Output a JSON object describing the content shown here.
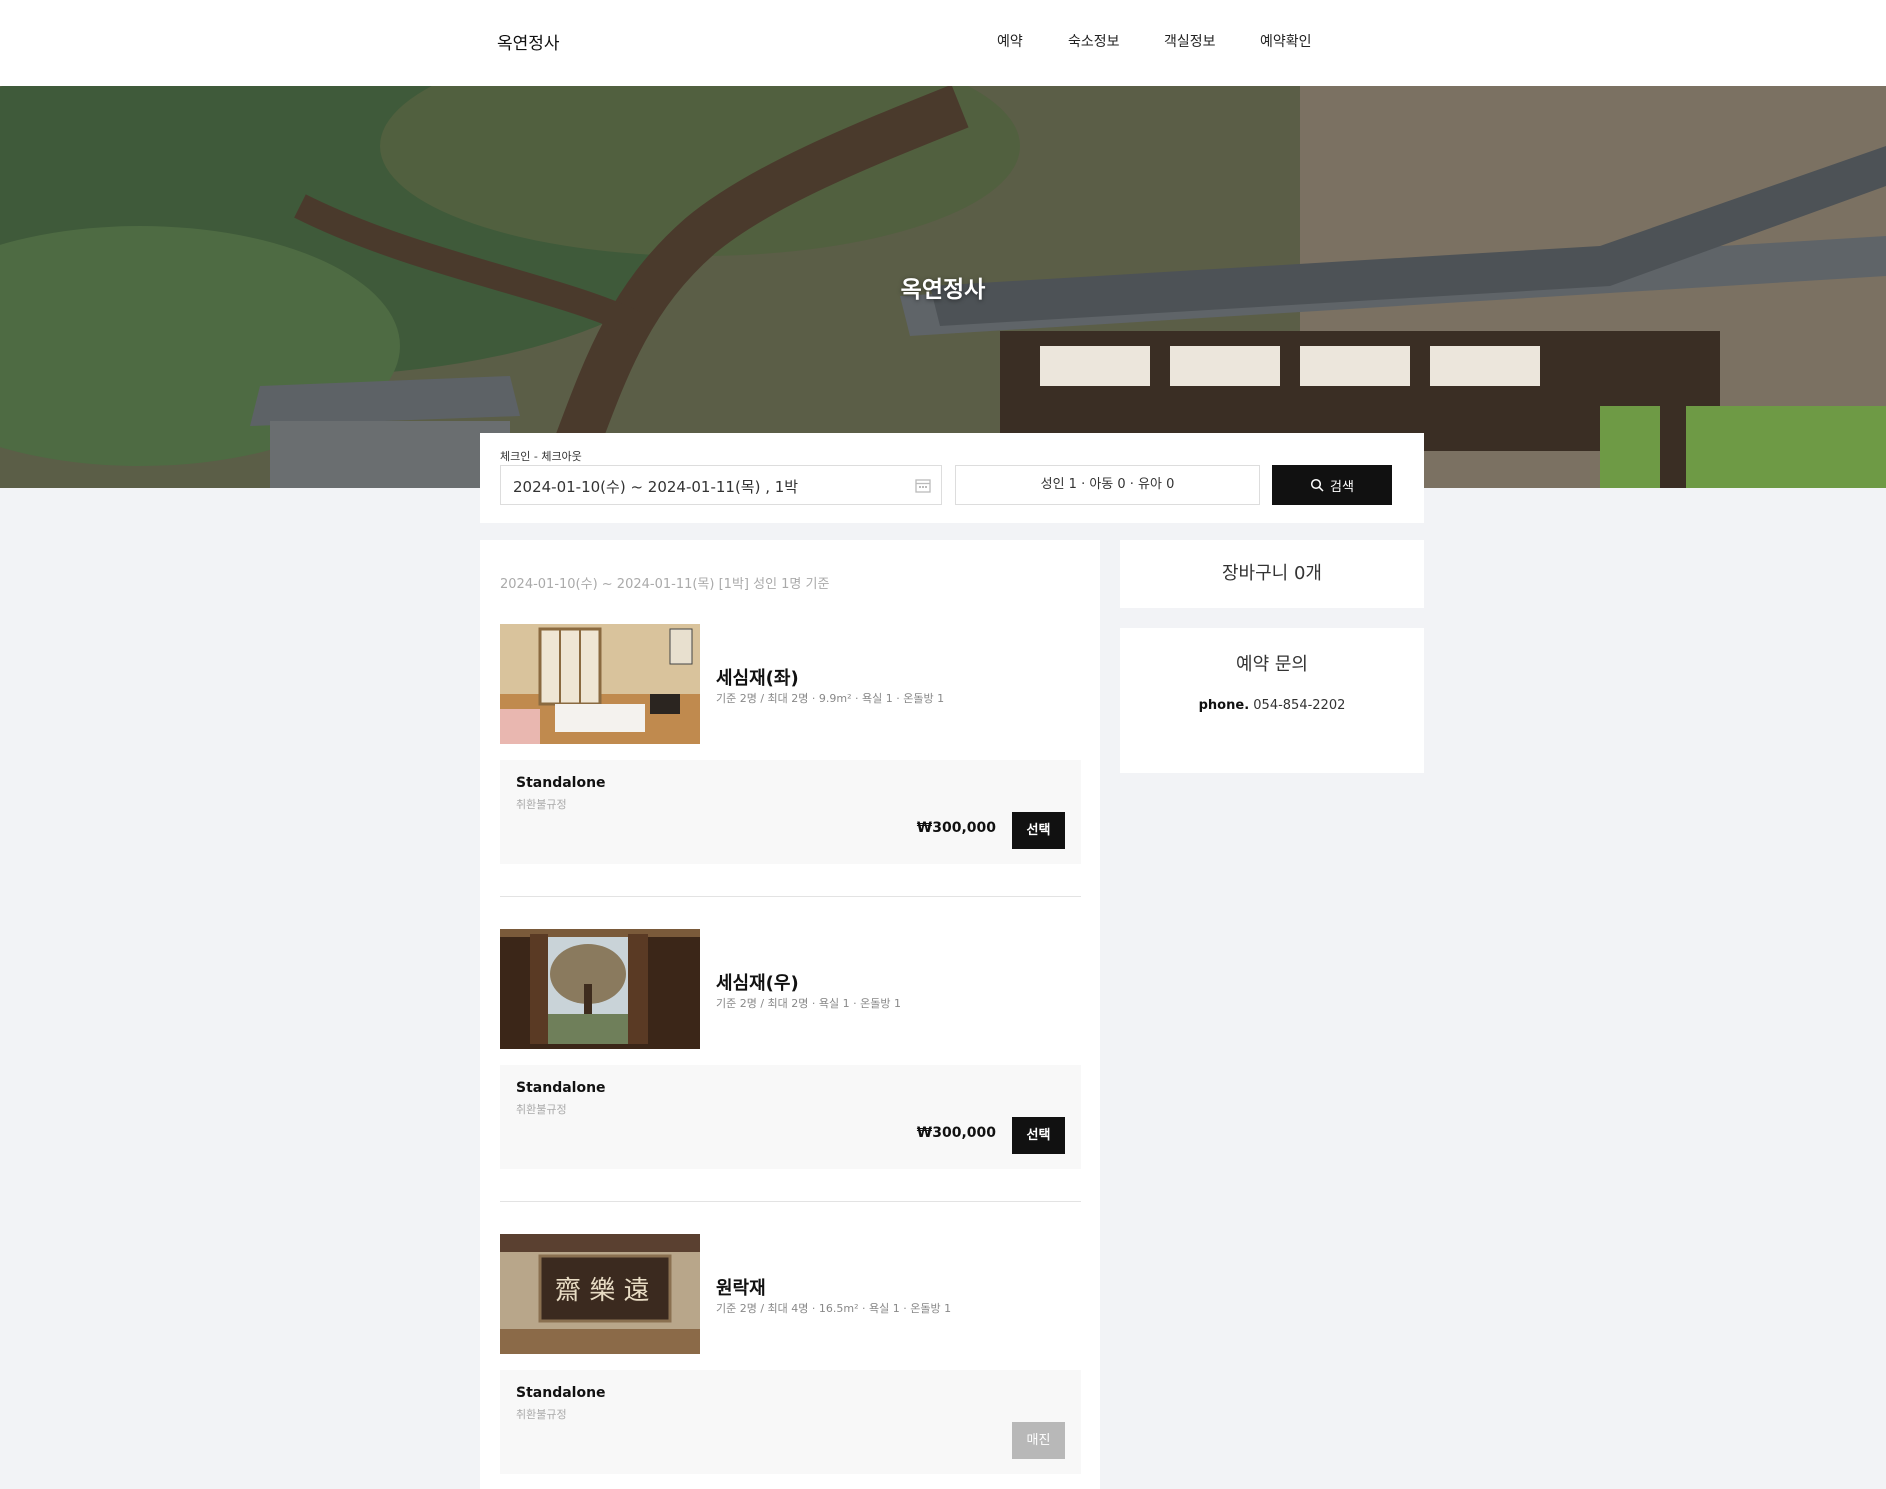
{
  "header": {
    "logo": "옥연정사",
    "nav": [
      "예약",
      "숙소정보",
      "객실정보",
      "예약확인"
    ]
  },
  "hero": {
    "title": "옥연정사"
  },
  "search": {
    "label": "체크인 - 체크아웃",
    "date_range": "2024-01-10(수)  ~ 2024-01-11(목) , 1박",
    "guests": "성인 1 · 아동 0 · 유아 0",
    "button": "검색"
  },
  "results": {
    "summary": "2024-01-10(수) ~ 2024-01-11(목) [1박] 성인 1명 기준",
    "rooms": [
      {
        "name": "세심재(좌)",
        "specs": "기준 2명 / 최대 2명 · 9.9m² · 욕실 1 · 온돌방 1",
        "plan": "Standalone",
        "policy": "취환불규정",
        "price": "₩300,000",
        "action": "선택"
      },
      {
        "name": "세심재(우)",
        "specs": "기준 2명 / 최대 2명 · 욕실 1 · 온돌방 1",
        "plan": "Standalone",
        "policy": "취환불규정",
        "price": "₩300,000",
        "action": "선택"
      },
      {
        "name": "원락재",
        "specs": "기준 2명 / 최대 4명 · 16.5m² · 욕실 1 · 온돌방 1",
        "plan": "Standalone",
        "policy": "취환불규정",
        "price": "",
        "action": "매진"
      }
    ]
  },
  "cart": {
    "label": "장바구니 0개"
  },
  "inquiry": {
    "title": "예약 문의",
    "phone_label": "phone.",
    "phone": "054-854-2202"
  },
  "colors": {
    "primary_button": "#111111",
    "background": "#f2f3f6",
    "soldout": "#b8b8b8"
  }
}
